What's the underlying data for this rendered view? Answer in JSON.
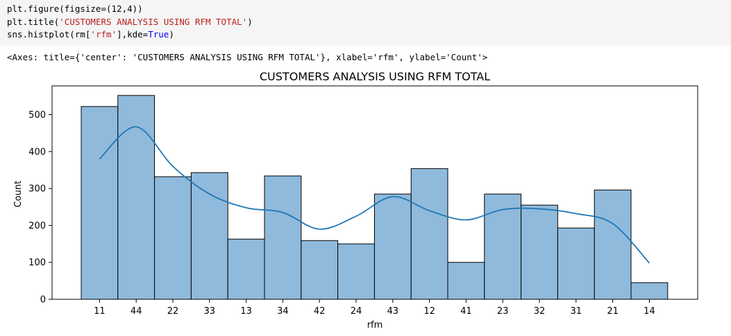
{
  "code_cell": {
    "line1": "plt.figure(figsize=(12,4))",
    "line2_prefix": "plt.title(",
    "line2_string": "'CUSTOMERS ANALYSIS USING RFM TOTAL'",
    "line2_suffix": ")",
    "line3_prefix": "sns.histplot(rm[",
    "line3_string": "'rfm'",
    "line3_middle": "],kde=",
    "line3_kw": "True",
    "line3_suffix": ")"
  },
  "output_text": "<Axes: title={'center': 'CUSTOMERS ANALYSIS USING RFM TOTAL'}, xlabel='rfm', ylabel='Count'>",
  "chart_data": {
    "type": "bar",
    "title": "CUSTOMERS ANALYSIS USING RFM TOTAL",
    "xlabel": "rfm",
    "ylabel": "Count",
    "categories": [
      "11",
      "44",
      "22",
      "33",
      "13",
      "34",
      "42",
      "24",
      "43",
      "12",
      "41",
      "23",
      "32",
      "31",
      "21",
      "14"
    ],
    "values": [
      522,
      552,
      332,
      343,
      163,
      334,
      159,
      150,
      285,
      354,
      100,
      285,
      255,
      193,
      296,
      45
    ],
    "kde": [
      380,
      467,
      360,
      285,
      248,
      235,
      190,
      225,
      278,
      240,
      215,
      243,
      245,
      232,
      205,
      98
    ],
    "ylim": [
      0,
      580
    ],
    "yticks": [
      0,
      100,
      200,
      300,
      400,
      500
    ],
    "grid": false,
    "bar_color": "#8fbadc",
    "bar_edge": "#000000",
    "kde_color": "#1f77b4"
  }
}
